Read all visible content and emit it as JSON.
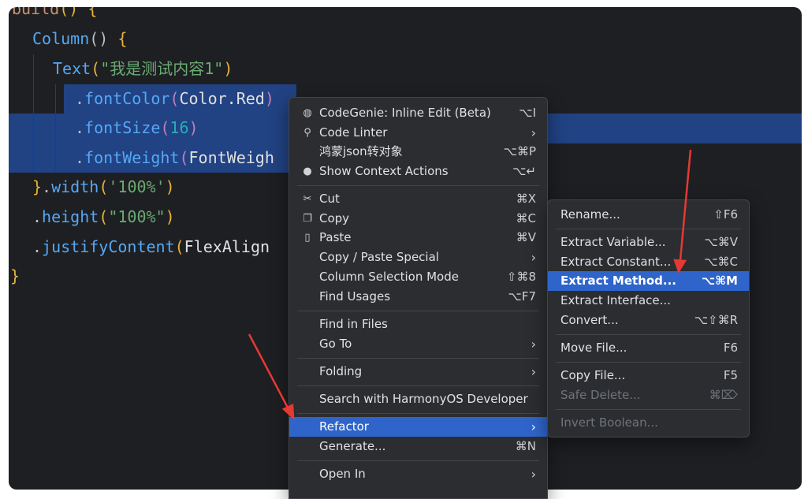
{
  "code": {
    "line0": {
      "name": "build",
      "open": "() {"
    },
    "line1": {
      "name": "Column",
      "paren": "()",
      "brace": "{"
    },
    "line2": {
      "name": "Text",
      "open": "(",
      "str": "\"我是测试内容1\"",
      "close": ")"
    },
    "line3": {
      "dot": ".",
      "fn": "fontColor",
      "open": "(",
      "arg": "Color.Red",
      "close": ")"
    },
    "line4": {
      "dot": ".",
      "fn": "fontSize",
      "open": "(",
      "arg": "16",
      "close": ")"
    },
    "line5": {
      "dot": ".",
      "fn": "fontWeight",
      "open": "(",
      "arg": "FontWeigh"
    },
    "line6": {
      "brace": "}",
      "dot": ".",
      "fn": "width",
      "open": "(",
      "str": "'100%'",
      "close": ")"
    },
    "line7": {
      "dot": ".",
      "fn": "height",
      "open": "(",
      "str": "\"100%\"",
      "close": ")"
    },
    "line8": {
      "dot": ".",
      "fn": "justifyContent",
      "open": "(",
      "arg": "FlexAlign"
    },
    "line9": {
      "brace": "}"
    }
  },
  "context_menu": {
    "items": [
      {
        "icon": "codegenie-icon",
        "glyph": "◍",
        "label": "CodeGenie: Inline Edit (Beta)",
        "shortcut": "⌥I"
      },
      {
        "icon": "code-linter-icon",
        "glyph": "⚲",
        "label": "Code Linter",
        "chevron": "›"
      },
      {
        "label": "鸿蒙json转对象",
        "shortcut": "⌥⌘P"
      },
      {
        "icon": "bulb-icon",
        "glyph": "●",
        "label": "Show Context Actions",
        "shortcut": "⌥↵"
      },
      {
        "icon": "cut-icon",
        "glyph": "✂",
        "label": "Cut",
        "shortcut": "⌘X"
      },
      {
        "icon": "copy-icon",
        "glyph": "❐",
        "label": "Copy",
        "shortcut": "⌘C"
      },
      {
        "icon": "paste-icon",
        "glyph": "▯",
        "label": "Paste",
        "shortcut": "⌘V"
      },
      {
        "label": "Copy / Paste Special",
        "chevron": "›"
      },
      {
        "label": "Column Selection Mode",
        "shortcut": "⇧⌘8"
      },
      {
        "label": "Find Usages",
        "shortcut": "⌥F7"
      },
      {
        "label": "Find in Files"
      },
      {
        "label": "Go To",
        "chevron": "›"
      },
      {
        "label": "Folding",
        "chevron": "›"
      },
      {
        "label": "Search with HarmonyOS Developer"
      },
      {
        "label": "Refactor",
        "chevron": "›"
      },
      {
        "label": "Generate...",
        "shortcut": "⌘N"
      },
      {
        "label": "Open In",
        "chevron": "›"
      }
    ]
  },
  "refactor_menu": {
    "items": [
      {
        "label": "Rename...",
        "shortcut": "⇧F6"
      },
      {
        "label": "Extract Variable...",
        "shortcut": "⌥⌘V"
      },
      {
        "label": "Extract Constant...",
        "shortcut": "⌥⌘C"
      },
      {
        "label": "Extract Method...",
        "shortcut": "⌥⌘M"
      },
      {
        "label": "Extract Interface..."
      },
      {
        "label": "Convert...",
        "shortcut": "⌥⇧⌘R"
      },
      {
        "label": "Move File...",
        "shortcut": "F6"
      },
      {
        "label": "Copy File...",
        "shortcut": "F5"
      },
      {
        "label": "Safe Delete...",
        "shortcut": "⌘⌦"
      },
      {
        "label": "Invert Boolean..."
      }
    ]
  },
  "colors": {
    "editor_bg": "#1e1f22",
    "selection": "#214283",
    "menu_bg": "#2b2d30",
    "highlight": "#2f65ca",
    "annotation_arrow": "#e53935"
  }
}
